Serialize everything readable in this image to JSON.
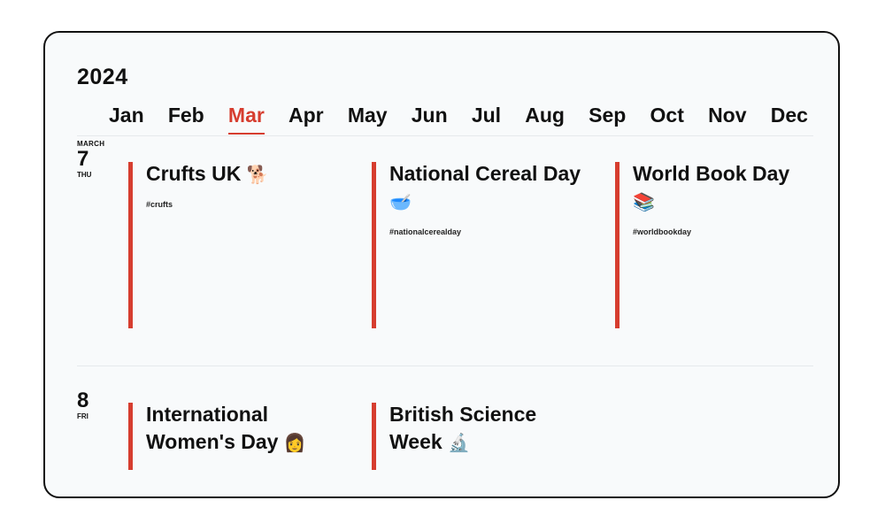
{
  "calendar": {
    "year": "2024",
    "months": [
      "Jan",
      "Feb",
      "Mar",
      "Apr",
      "May",
      "Jun",
      "Jul",
      "Aug",
      "Sep",
      "Oct",
      "Nov",
      "Dec"
    ],
    "active_month": "Mar",
    "accent_color": "#d63d2f",
    "days": [
      {
        "month_label": "MARCH",
        "day_number": "7",
        "weekday": "THU",
        "events": [
          {
            "title": "Crufts UK",
            "emoji": "🐕",
            "tag": "#crufts"
          },
          {
            "title": "National Cereal Day",
            "emoji": "🥣",
            "tag": "#nationalcerealday"
          },
          {
            "title": "World Book Day",
            "emoji": "📚",
            "tag": "#worldbookday"
          }
        ]
      },
      {
        "month_label": "",
        "day_number": "8",
        "weekday": "FRI",
        "events": [
          {
            "title": "International Women's Day",
            "emoji": "👩",
            "tag": ""
          },
          {
            "title": "British Science Week",
            "emoji": "🔬",
            "tag": ""
          }
        ]
      }
    ]
  }
}
